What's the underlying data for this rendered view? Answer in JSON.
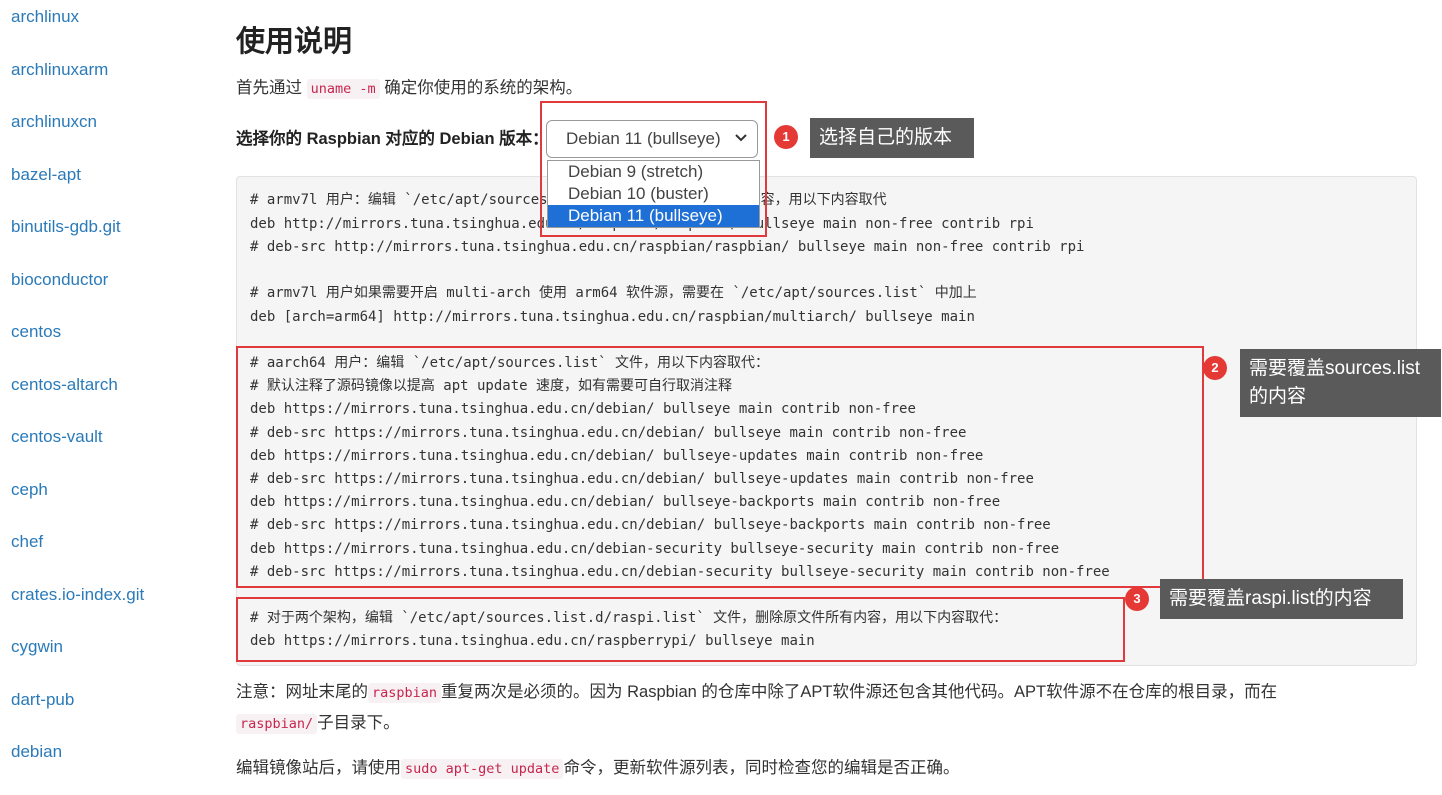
{
  "sidebar": {
    "items": [
      "archlinux",
      "archlinuxarm",
      "archlinuxcn",
      "bazel-apt",
      "binutils-gdb.git",
      "bioconductor",
      "centos",
      "centos-altarch",
      "centos-vault",
      "ceph",
      "chef",
      "crates.io-index.git",
      "cygwin",
      "dart-pub",
      "debian"
    ]
  },
  "main": {
    "title": "使用说明",
    "intro": {
      "before": "首先通过 ",
      "code": "uname -m",
      "after": " 确定你使用的系统的架构。"
    },
    "version_label": "选择你的 Raspbian 对应的 Debian 版本：",
    "select_value": "Debian 11 (bullseye)",
    "options": [
      "Debian 9 (stretch)",
      "Debian 10 (buster)",
      "Debian 11 (bullseye)"
    ],
    "code_lines": [
      "# armv7l 用户：编辑 `/etc/apt/sources.list` 文件，删除原文件所有内容，用以下内容取代",
      "deb http://mirrors.tuna.tsinghua.edu.cn/raspbian/raspbian/ bullseye main non-free contrib rpi",
      "# deb-src http://mirrors.tuna.tsinghua.edu.cn/raspbian/raspbian/ bullseye main non-free contrib rpi",
      "# armv7l 用户如果需要开启 multi-arch 使用 arm64 软件源，需要在 `/etc/apt/sources.list` 中加上",
      "deb [arch=arm64] http://mirrors.tuna.tsinghua.edu.cn/raspbian/multiarch/ bullseye main",
      "# aarch64 用户：编辑 `/etc/apt/sources.list` 文件，用以下内容取代：",
      "# 默认注释了源码镜像以提高 apt update 速度，如有需要可自行取消注释",
      "deb https://mirrors.tuna.tsinghua.edu.cn/debian/ bullseye main contrib non-free",
      "# deb-src https://mirrors.tuna.tsinghua.edu.cn/debian/ bullseye main contrib non-free",
      "deb https://mirrors.tuna.tsinghua.edu.cn/debian/ bullseye-updates main contrib non-free",
      "# deb-src https://mirrors.tuna.tsinghua.edu.cn/debian/ bullseye-updates main contrib non-free",
      "deb https://mirrors.tuna.tsinghua.edu.cn/debian/ bullseye-backports main contrib non-free",
      "# deb-src https://mirrors.tuna.tsinghua.edu.cn/debian/ bullseye-backports main contrib non-free",
      "deb https://mirrors.tuna.tsinghua.edu.cn/debian-security bullseye-security main contrib non-free",
      "# deb-src https://mirrors.tuna.tsinghua.edu.cn/debian-security bullseye-security main contrib non-free",
      "# 对于两个架构，编辑 `/etc/apt/sources.list.d/raspi.list` 文件，删除原文件所有内容，用以下内容取代：",
      "deb https://mirrors.tuna.tsinghua.edu.cn/raspberrypi/ bullseye main"
    ],
    "note": {
      "p1": "注意：网址末尾的",
      "code1": "raspbian",
      "p2": "重复两次是必须的。因为 Raspbian 的仓库中除了APT软件源还包含其他代码。APT软件源不在仓库的根目录，而在",
      "code2": "raspbian/",
      "p3": "子目录下。"
    },
    "edit_note": {
      "p1": "编辑镜像站后，请使用",
      "code": "sudo apt-get update",
      "p2": "命令，更新软件源列表，同时检查您的编辑是否正确。"
    }
  },
  "annotations": {
    "badges": [
      "1",
      "2",
      "3"
    ],
    "callout1": "选择自己的版本",
    "callout2_line1": "需要覆盖sources.list",
    "callout2_line2": "的内容",
    "callout3": "需要覆盖raspi.list的内容"
  },
  "colors": {
    "link": "#2a7ab9",
    "highlight": "#e03a3e",
    "callout_bg": "#5a5a5a",
    "selected_option": "#1e6fd6",
    "inline_code": "#c7254e"
  }
}
